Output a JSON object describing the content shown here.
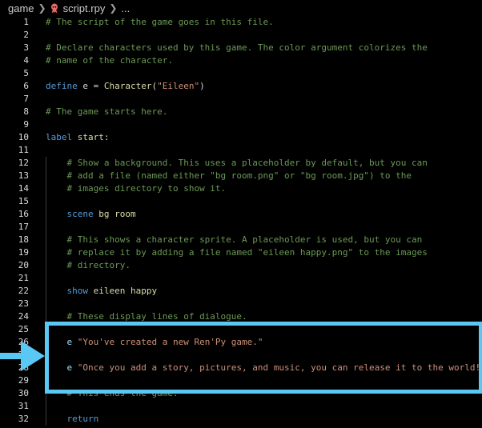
{
  "breadcrumb": {
    "folder": "game",
    "file": "script.rpy",
    "ellipsis": "..."
  },
  "icons": {
    "separator": "chevron-right-icon",
    "file": "renpy-file-icon",
    "pointer": "arrow-right-icon"
  },
  "colors": {
    "comment": "#6a9955",
    "keyword": "#569cd6",
    "function": "#dcdcaa",
    "string": "#ce9178",
    "variable": "#9cdcfe",
    "highlight": "#5ac8f5",
    "file_icon": "#e86a6a"
  },
  "lines": [
    {
      "n": "1",
      "tokens": [
        {
          "t": "# The script of the game goes in this file.",
          "c": "comment"
        }
      ]
    },
    {
      "n": "2",
      "tokens": []
    },
    {
      "n": "3",
      "tokens": [
        {
          "t": "# Declare characters used by this game. The color argument colorizes the",
          "c": "comment"
        }
      ]
    },
    {
      "n": "4",
      "tokens": [
        {
          "t": "# name of the character.",
          "c": "comment"
        }
      ]
    },
    {
      "n": "5",
      "tokens": []
    },
    {
      "n": "6",
      "tokens": [
        {
          "t": "define",
          "c": "keyword"
        },
        {
          "t": " e = ",
          "c": "text"
        },
        {
          "t": "Character",
          "c": "fn"
        },
        {
          "t": "(",
          "c": "text"
        },
        {
          "t": "\"Eileen\"",
          "c": "string"
        },
        {
          "t": ")",
          "c": "text"
        }
      ]
    },
    {
      "n": "7",
      "tokens": []
    },
    {
      "n": "8",
      "tokens": [
        {
          "t": "# The game starts here.",
          "c": "comment"
        }
      ]
    },
    {
      "n": "9",
      "tokens": []
    },
    {
      "n": "10",
      "tokens": [
        {
          "t": "label",
          "c": "keyword"
        },
        {
          "t": " start:",
          "c": "fn"
        }
      ]
    },
    {
      "n": "11",
      "tokens": []
    },
    {
      "n": "12",
      "indent": true,
      "tokens": [
        {
          "t": "# Show a background. This uses a placeholder by default, but you can",
          "c": "comment"
        }
      ]
    },
    {
      "n": "13",
      "indent": true,
      "tokens": [
        {
          "t": "# add a file (named either \"bg room.png\" or \"bg room.jpg\") to the",
          "c": "comment"
        }
      ]
    },
    {
      "n": "14",
      "indent": true,
      "tokens": [
        {
          "t": "# images directory to show it.",
          "c": "comment"
        }
      ]
    },
    {
      "n": "15",
      "indent": true,
      "tokens": []
    },
    {
      "n": "16",
      "indent": true,
      "tokens": [
        {
          "t": "scene",
          "c": "keyword"
        },
        {
          "t": " bg room",
          "c": "fn"
        }
      ]
    },
    {
      "n": "17",
      "indent": true,
      "tokens": []
    },
    {
      "n": "18",
      "indent": true,
      "tokens": [
        {
          "t": "# This shows a character sprite. A placeholder is used, but you can",
          "c": "comment"
        }
      ]
    },
    {
      "n": "19",
      "indent": true,
      "tokens": [
        {
          "t": "# replace it by adding a file named \"eileen happy.png\" to the images",
          "c": "comment"
        }
      ]
    },
    {
      "n": "20",
      "indent": true,
      "tokens": [
        {
          "t": "# directory.",
          "c": "comment"
        }
      ]
    },
    {
      "n": "21",
      "indent": true,
      "tokens": []
    },
    {
      "n": "22",
      "indent": true,
      "tokens": [
        {
          "t": "show",
          "c": "keyword"
        },
        {
          "t": " eileen happy",
          "c": "fn"
        }
      ]
    },
    {
      "n": "23",
      "indent": true,
      "tokens": []
    },
    {
      "n": "24",
      "indent": true,
      "tokens": [
        {
          "t": "# These display lines of dialogue.",
          "c": "comment"
        }
      ]
    },
    {
      "n": "25",
      "indent": true,
      "tokens": []
    },
    {
      "n": "26",
      "indent": true,
      "tokens": [
        {
          "t": "e",
          "c": "var"
        },
        {
          "t": " ",
          "c": "text"
        },
        {
          "t": "\"You've created a new Ren'Py game.\"",
          "c": "string"
        }
      ]
    },
    {
      "n": "27",
      "indent": true,
      "tokens": []
    },
    {
      "n": "28",
      "indent": true,
      "tokens": [
        {
          "t": "e",
          "c": "var"
        },
        {
          "t": " ",
          "c": "text"
        },
        {
          "t": "\"Once you add a story, pictures, and music, you can release it to the world!\"",
          "c": "string"
        }
      ]
    },
    {
      "n": "29",
      "indent": true,
      "tokens": []
    },
    {
      "n": "30",
      "indent": true,
      "tokens": [
        {
          "t": "# This ends the game.",
          "c": "comment"
        }
      ]
    },
    {
      "n": "31",
      "indent": true,
      "tokens": []
    },
    {
      "n": "32",
      "indent": true,
      "tokens": [
        {
          "t": "return",
          "c": "keyword"
        }
      ]
    }
  ]
}
